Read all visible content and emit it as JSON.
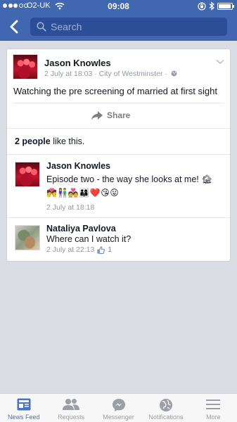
{
  "status_bar": {
    "carrier": "O2-UK",
    "time": "09:08",
    "signal_bars_filled": 3,
    "signal_bars_total": 5,
    "battery_level": 0.95
  },
  "search": {
    "placeholder": "Search"
  },
  "post": {
    "author": "Jason Knowles",
    "date": "2 July at 18:03",
    "separator": "·",
    "location": "City of Westminster",
    "meta_separator": "·",
    "text": "Watching the pre screening of married at first sight",
    "share_label": "Share"
  },
  "likes": {
    "count_text": "2 people",
    "suffix": " like this."
  },
  "comments": [
    {
      "author": "Jason Knowles",
      "text": "Episode two - the way she looks at me! 🏚",
      "emoji_line": "💏👫💑👨‍👩‍👦❤️😘😛",
      "time": "2 July at 18:18"
    },
    {
      "author": "Nataliya Pavlova",
      "text": "Where can I watch it?",
      "time": "2 July at 22:13",
      "like_count": "1"
    }
  ],
  "tabs": [
    {
      "label": "News Feed",
      "icon": "news-feed-icon",
      "active": true
    },
    {
      "label": "Requests",
      "icon": "friend-requests-icon",
      "active": false
    },
    {
      "label": "Messenger",
      "icon": "messenger-icon",
      "active": false
    },
    {
      "label": "Notifications",
      "icon": "globe-notifications-icon",
      "active": false
    },
    {
      "label": "More",
      "icon": "hamburger-menu-icon",
      "active": false
    }
  ],
  "colors": {
    "header": "#4167b0",
    "search_field": "#2b4e96",
    "background": "#d9dce3",
    "active_tab": "#4a73c6",
    "inactive_tab": "#9b9ea4",
    "meta_text": "#9197a3"
  }
}
